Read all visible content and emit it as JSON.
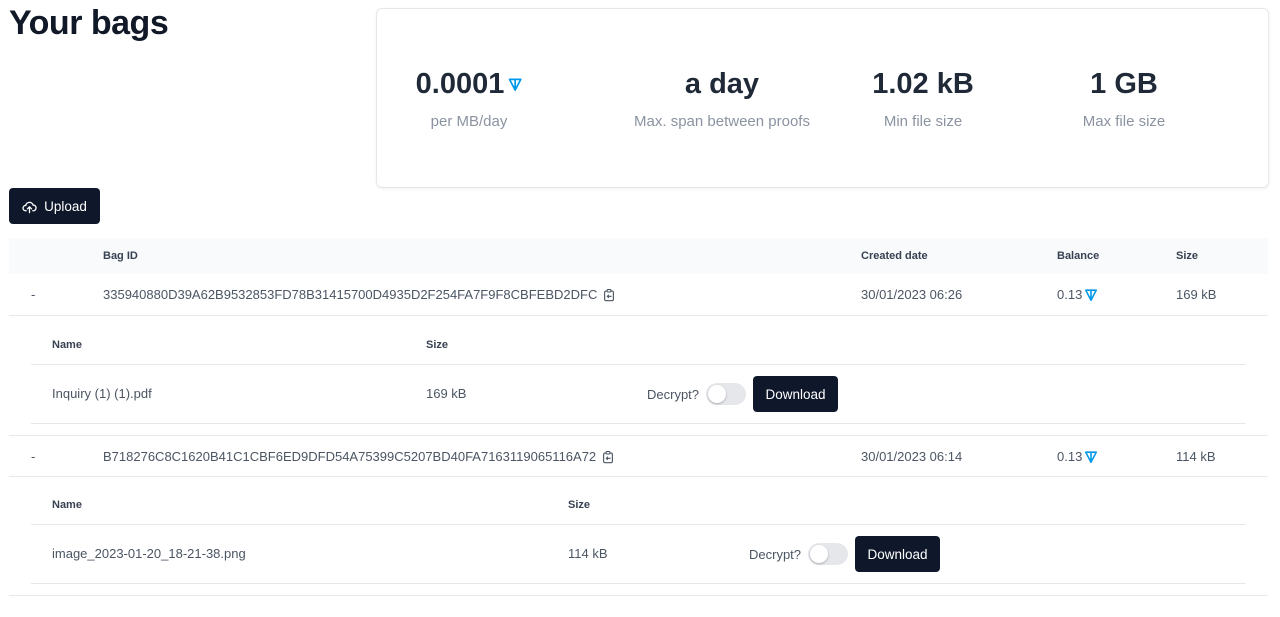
{
  "page": {
    "title": "Your bags"
  },
  "stats": [
    {
      "value": "0.0001",
      "label": "per MB/day",
      "icon": "ton-icon"
    },
    {
      "value": "a day",
      "label": "Max. span between proofs"
    },
    {
      "value": "1.02 kB",
      "label": "Min file size"
    },
    {
      "value": "1 GB",
      "label": "Max file size"
    }
  ],
  "toolbar": {
    "upload_label": "Upload",
    "upload_icon": "cloud-upload-icon"
  },
  "table": {
    "headers": {
      "bag_id": "Bag ID",
      "created": "Created date",
      "balance": "Balance",
      "size": "Size"
    },
    "bags": [
      {
        "toggle": "-",
        "id": "335940880D39A62B9532853FD78B31415700D4935D2F254FA7F9F8CBFEBD2DFC",
        "created": "30/01/2023 06:26",
        "balance": "0.13",
        "size": "169 kB",
        "files_headers": {
          "name": "Name",
          "size": "Size"
        },
        "files": [
          {
            "name": "Inquiry (1) (1).pdf",
            "size": "169 kB",
            "decrypt_label": "Decrypt?",
            "decrypt_on": false,
            "download_label": "Download"
          }
        ]
      },
      {
        "toggle": "-",
        "id": "B718276C8C1620B41C1CBF6ED9DFD54A75399C5207BD40FA7163119065116A72",
        "created": "30/01/2023 06:14",
        "balance": "0.13",
        "size": "114 kB",
        "files_headers": {
          "name": "Name",
          "size": "Size"
        },
        "files": [
          {
            "name": "image_2023-01-20_18-21-38.png",
            "size": "114 kB",
            "decrypt_label": "Decrypt?",
            "decrypt_on": false,
            "download_label": "Download"
          }
        ]
      }
    ]
  },
  "colors": {
    "accent": "#0098ea",
    "button_bg": "#0f172a",
    "muted_text": "#8b93a1"
  }
}
